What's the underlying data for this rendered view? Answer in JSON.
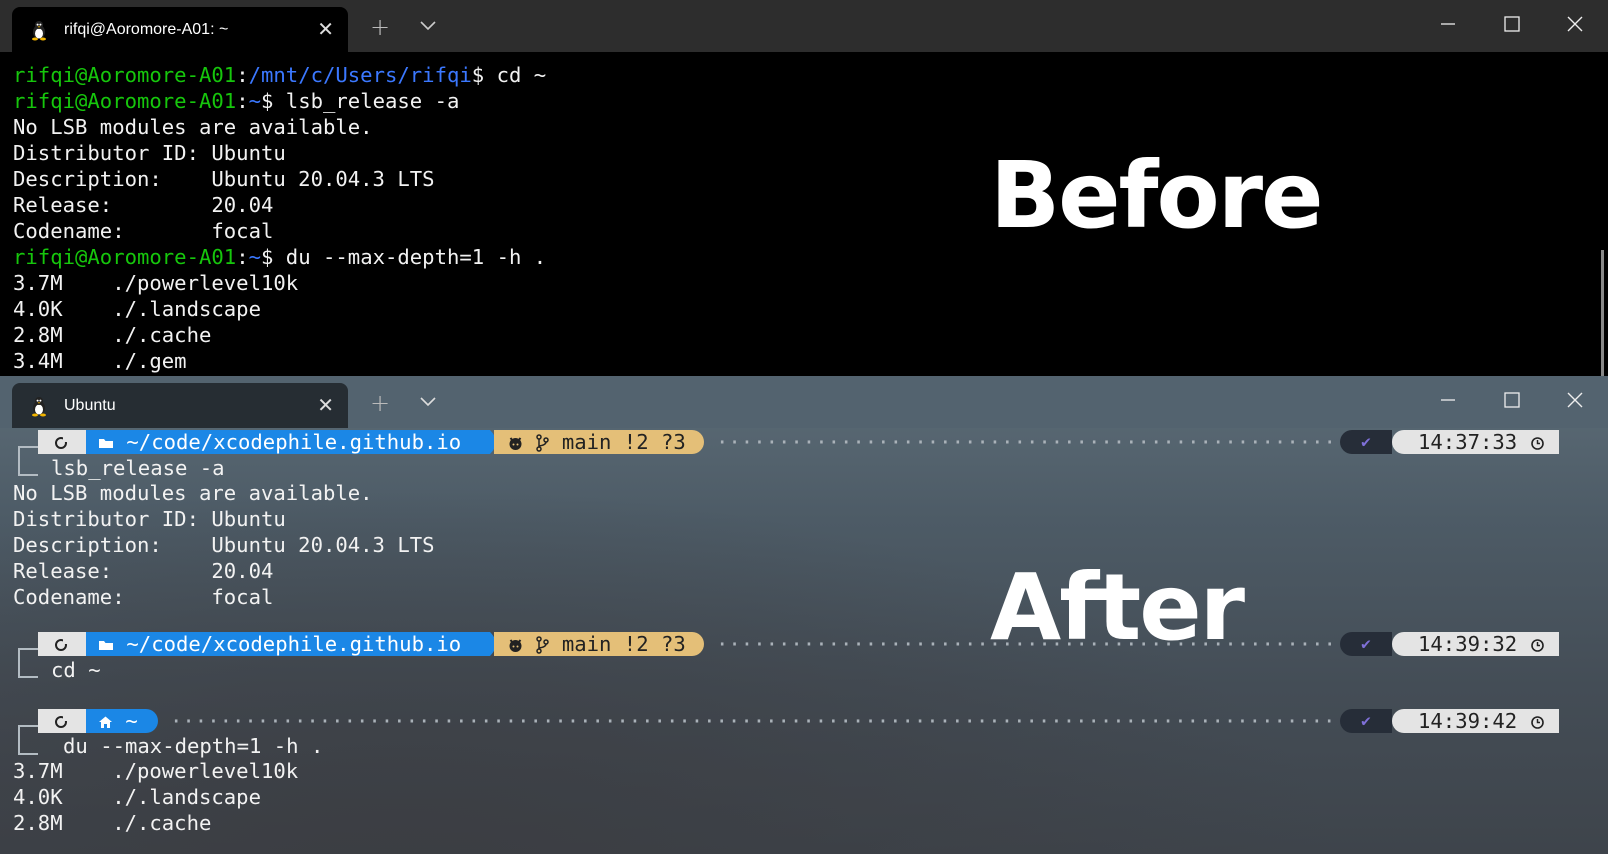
{
  "before_window": {
    "tab_title": "rifqi@Aoromore-A01: ~",
    "lines": [
      [
        {
          "t": "rifqi@Aoromore-A01",
          "c": "g"
        },
        {
          "t": ":",
          "c": "w"
        },
        {
          "t": "/mnt/c/Users/rifqi",
          "c": "b"
        },
        {
          "t": "$ cd ~",
          "c": "w"
        }
      ],
      [
        {
          "t": "rifqi@Aoromore-A01",
          "c": "g"
        },
        {
          "t": ":",
          "c": "w"
        },
        {
          "t": "~",
          "c": "b"
        },
        {
          "t": "$ lsb_release -a",
          "c": "w"
        }
      ],
      [
        {
          "t": "No LSB modules are available.",
          "c": "w"
        }
      ],
      [
        {
          "t": "Distributor ID: Ubuntu",
          "c": "w"
        }
      ],
      [
        {
          "t": "Description:    Ubuntu 20.04.3 LTS",
          "c": "w"
        }
      ],
      [
        {
          "t": "Release:        20.04",
          "c": "w"
        }
      ],
      [
        {
          "t": "Codename:       focal",
          "c": "w"
        }
      ],
      [
        {
          "t": "rifqi@Aoromore-A01",
          "c": "g"
        },
        {
          "t": ":",
          "c": "w"
        },
        {
          "t": "~",
          "c": "b"
        },
        {
          "t": "$ du --max-depth=1 -h .",
          "c": "w"
        }
      ],
      [
        {
          "t": "3.7M    ./powerlevel10k",
          "c": "w"
        }
      ],
      [
        {
          "t": "4.0K    ./.landscape",
          "c": "w"
        }
      ],
      [
        {
          "t": "2.8M    ./.cache",
          "c": "w"
        }
      ],
      [
        {
          "t": "3.4M    ./.gem",
          "c": "w"
        }
      ]
    ],
    "overlay_label": "Before"
  },
  "after_window": {
    "tab_title": "Ubuntu",
    "overlay_label": "After",
    "prompts": [
      {
        "dir": "~/code/xcodephile.github.io",
        "git": "main !2 ?3",
        "time": "14:37:33",
        "command": "lsb_release -a"
      },
      {
        "dir": "~/code/xcodephile.github.io",
        "git": "main !2 ?3",
        "time": "14:39:32",
        "command": "cd ~"
      },
      {
        "dir": "~",
        "git": "",
        "time": "14:39:42",
        "command": "du --max-depth=1 -h ."
      }
    ],
    "output_1": [
      "No LSB modules are available.",
      "Distributor ID: Ubuntu",
      "Description:    Ubuntu 20.04.3 LTS",
      "Release:        20.04",
      "Codename:       focal"
    ],
    "output_3": [
      "3.7M    ./powerlevel10k",
      "4.0K    ./.landscape",
      "2.8M    ./.cache"
    ]
  },
  "icons": {
    "tab": "linux-penguin-icon",
    "new_tab": "plus-icon",
    "dropdown": "chevron-down-icon",
    "minimize": "minimize-icon",
    "maximize": "maximize-icon",
    "close": "close-icon",
    "os": "os-icon",
    "folder": "folder-icon",
    "home": "home-icon",
    "github": "github-icon",
    "branch": "git-branch-icon",
    "status_ok": "checkmark-icon",
    "clock": "clock-icon"
  },
  "colors": {
    "user_host": "#16c60c",
    "path": "#3b78ff",
    "dir_segment": "#1b87e6",
    "git_segment": "#e4bf78",
    "os_segment": "#e4e4e4",
    "ok_segment": "#262d38"
  }
}
